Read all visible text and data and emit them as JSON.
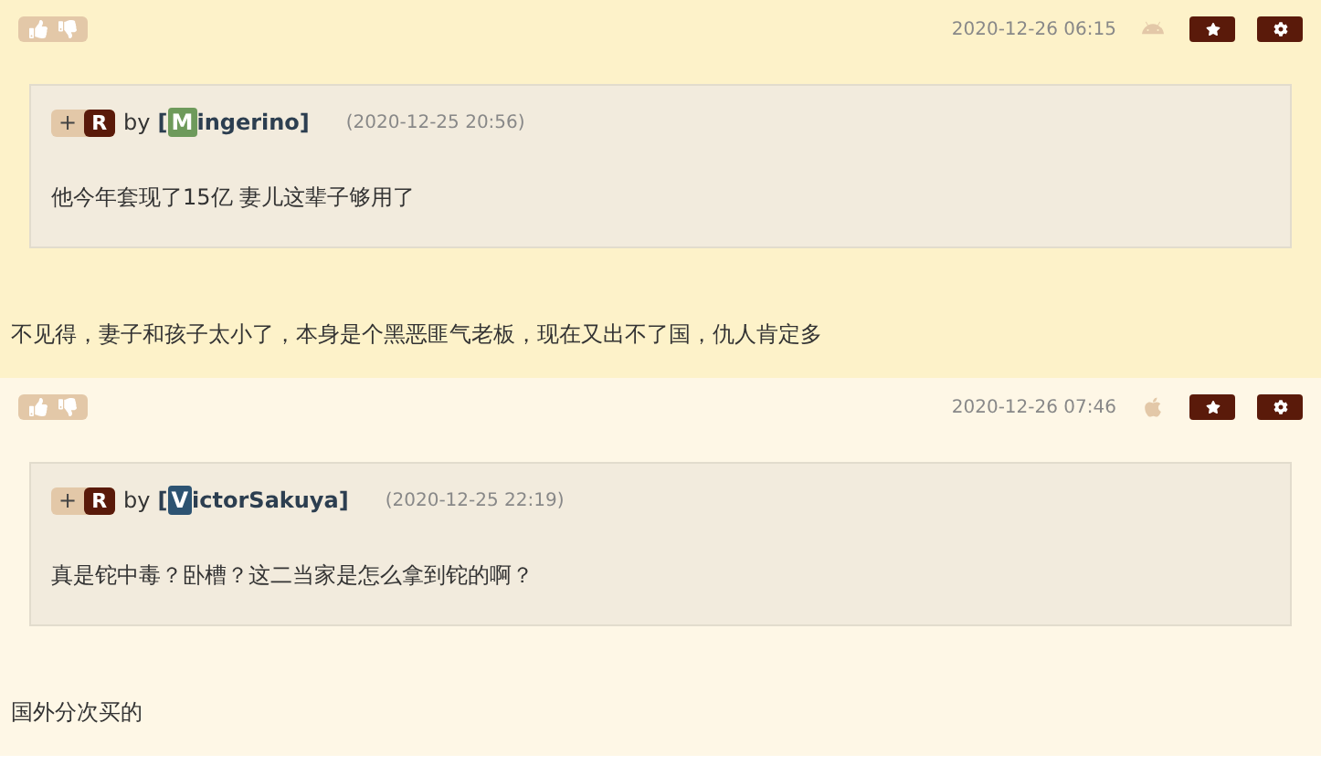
{
  "posts": [
    {
      "color": "#fdf2c9",
      "kind": "android",
      "time": "2020-12-26 06:15",
      "quote": {
        "plus": "+",
        "badge": "R",
        "by": "by",
        "open": "[",
        "initial": "M",
        "color": "#6e9a5b",
        "name_rest": "ingerino",
        "close": "]",
        "time": "(2020-12-25 20:56)",
        "text": "他今年套现了15亿 妻儿这辈子够用了"
      },
      "reply": "不见得，妻子和孩子太小了，本身是个黑恶匪气老板，现在又出不了国，仇人肯定多"
    },
    {
      "color": "#fef7e6",
      "kind": "apple",
      "time": "2020-12-26 07:46",
      "quote": {
        "plus": "+",
        "badge": "R",
        "by": "by",
        "open": "[",
        "initial": "V",
        "color": "#2d5372",
        "name_rest": "ictorSakuya",
        "close": "]",
        "time": "(2020-12-25 22:19)",
        "text": "真是铊中毒？卧槽？这二当家是怎么拿到铊的啊？"
      },
      "reply": "国外分次买的"
    }
  ]
}
